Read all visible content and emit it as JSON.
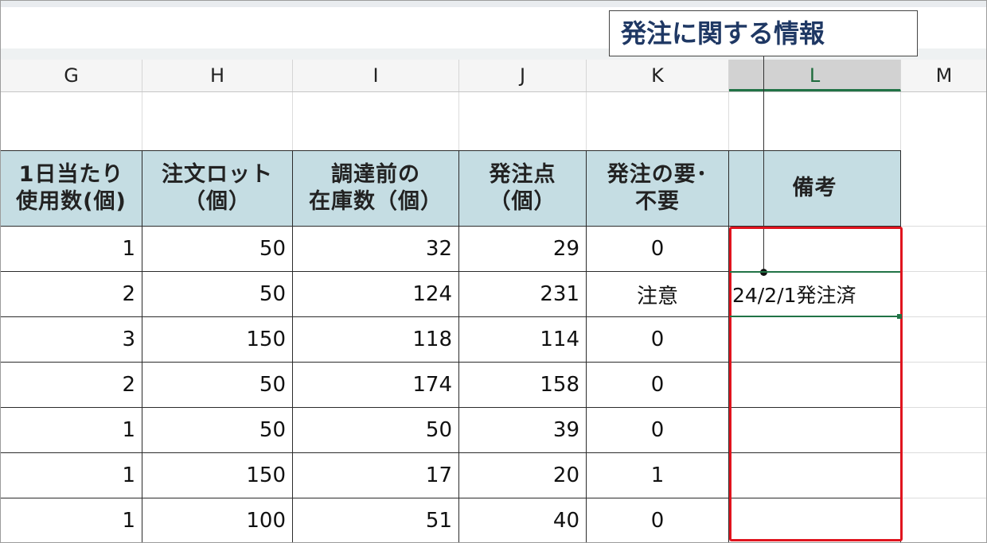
{
  "callout": {
    "text": "発注に関する情報"
  },
  "column_headers": [
    "G",
    "H",
    "I",
    "J",
    "K",
    "L",
    "M"
  ],
  "selected_column": "L",
  "table": {
    "headers": [
      [
        "1日当たり",
        "使用数(個)"
      ],
      [
        "注文ロット",
        "（個）"
      ],
      [
        "調達前の",
        "在庫数（個）"
      ],
      [
        "発注点",
        "（個）"
      ],
      [
        "発注の要･",
        "不要"
      ],
      [
        "備考"
      ]
    ],
    "rows": [
      [
        "1",
        "50",
        "32",
        "29",
        "0",
        ""
      ],
      [
        "2",
        "50",
        "124",
        "231",
        "注意",
        "24/2/1発注済"
      ],
      [
        "3",
        "150",
        "118",
        "114",
        "0",
        ""
      ],
      [
        "2",
        "50",
        "174",
        "158",
        "0",
        ""
      ],
      [
        "1",
        "50",
        "50",
        "39",
        "0",
        ""
      ],
      [
        "1",
        "150",
        "17",
        "20",
        "1",
        ""
      ],
      [
        "1",
        "100",
        "51",
        "40",
        "0",
        ""
      ]
    ]
  },
  "colors": {
    "header_fill": "#c5dde3",
    "highlight_border": "#e0141e",
    "selection_green": "#217346",
    "callout_text": "#1f3864"
  }
}
